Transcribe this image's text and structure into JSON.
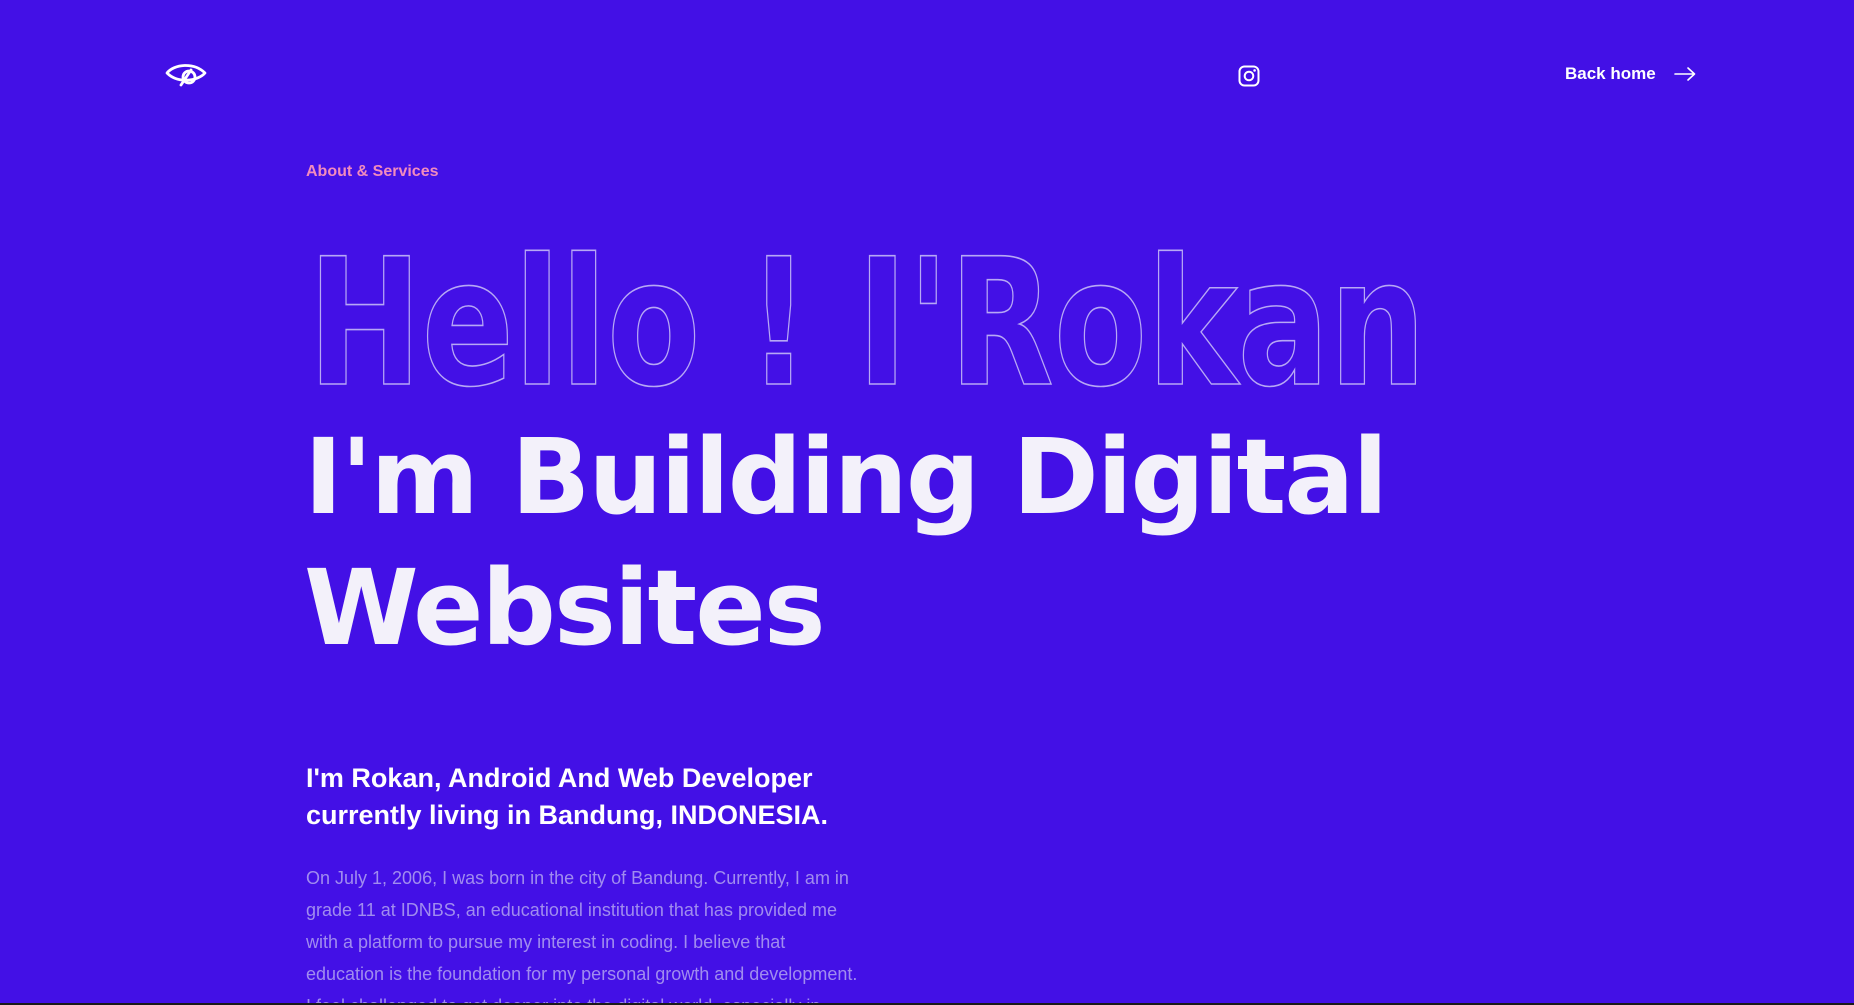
{
  "header": {
    "logo_icon": "eye-logo-icon",
    "social_icon": "instagram-icon",
    "back_home_label": "Back home",
    "back_home_icon": "arrow-right-icon"
  },
  "hero": {
    "eyebrow": "About & Services",
    "outline_title": "Hello ! I'Rokan",
    "headline": "I'm Building Digital Websites"
  },
  "about": {
    "intro": "I'm Rokan, Android And Web Developer currently living in Bandung, INDONESIA.",
    "bio": "On July 1, 2006, I was born in the city of Bandung. Currently, I am in grade 11 at IDNBS, an educational institution that has provided me with a platform to pursue my interest in coding. I believe that education is the foundation for my personal growth and development. I feel challenged to get deeper into the digital world, especially in coding"
  },
  "colors": {
    "background": "#4310e6",
    "accent_pink": "#f28bbd",
    "text_white": "#ffffff",
    "text_muted": "#a08cef",
    "outline_stroke": "#b7a8f5"
  }
}
